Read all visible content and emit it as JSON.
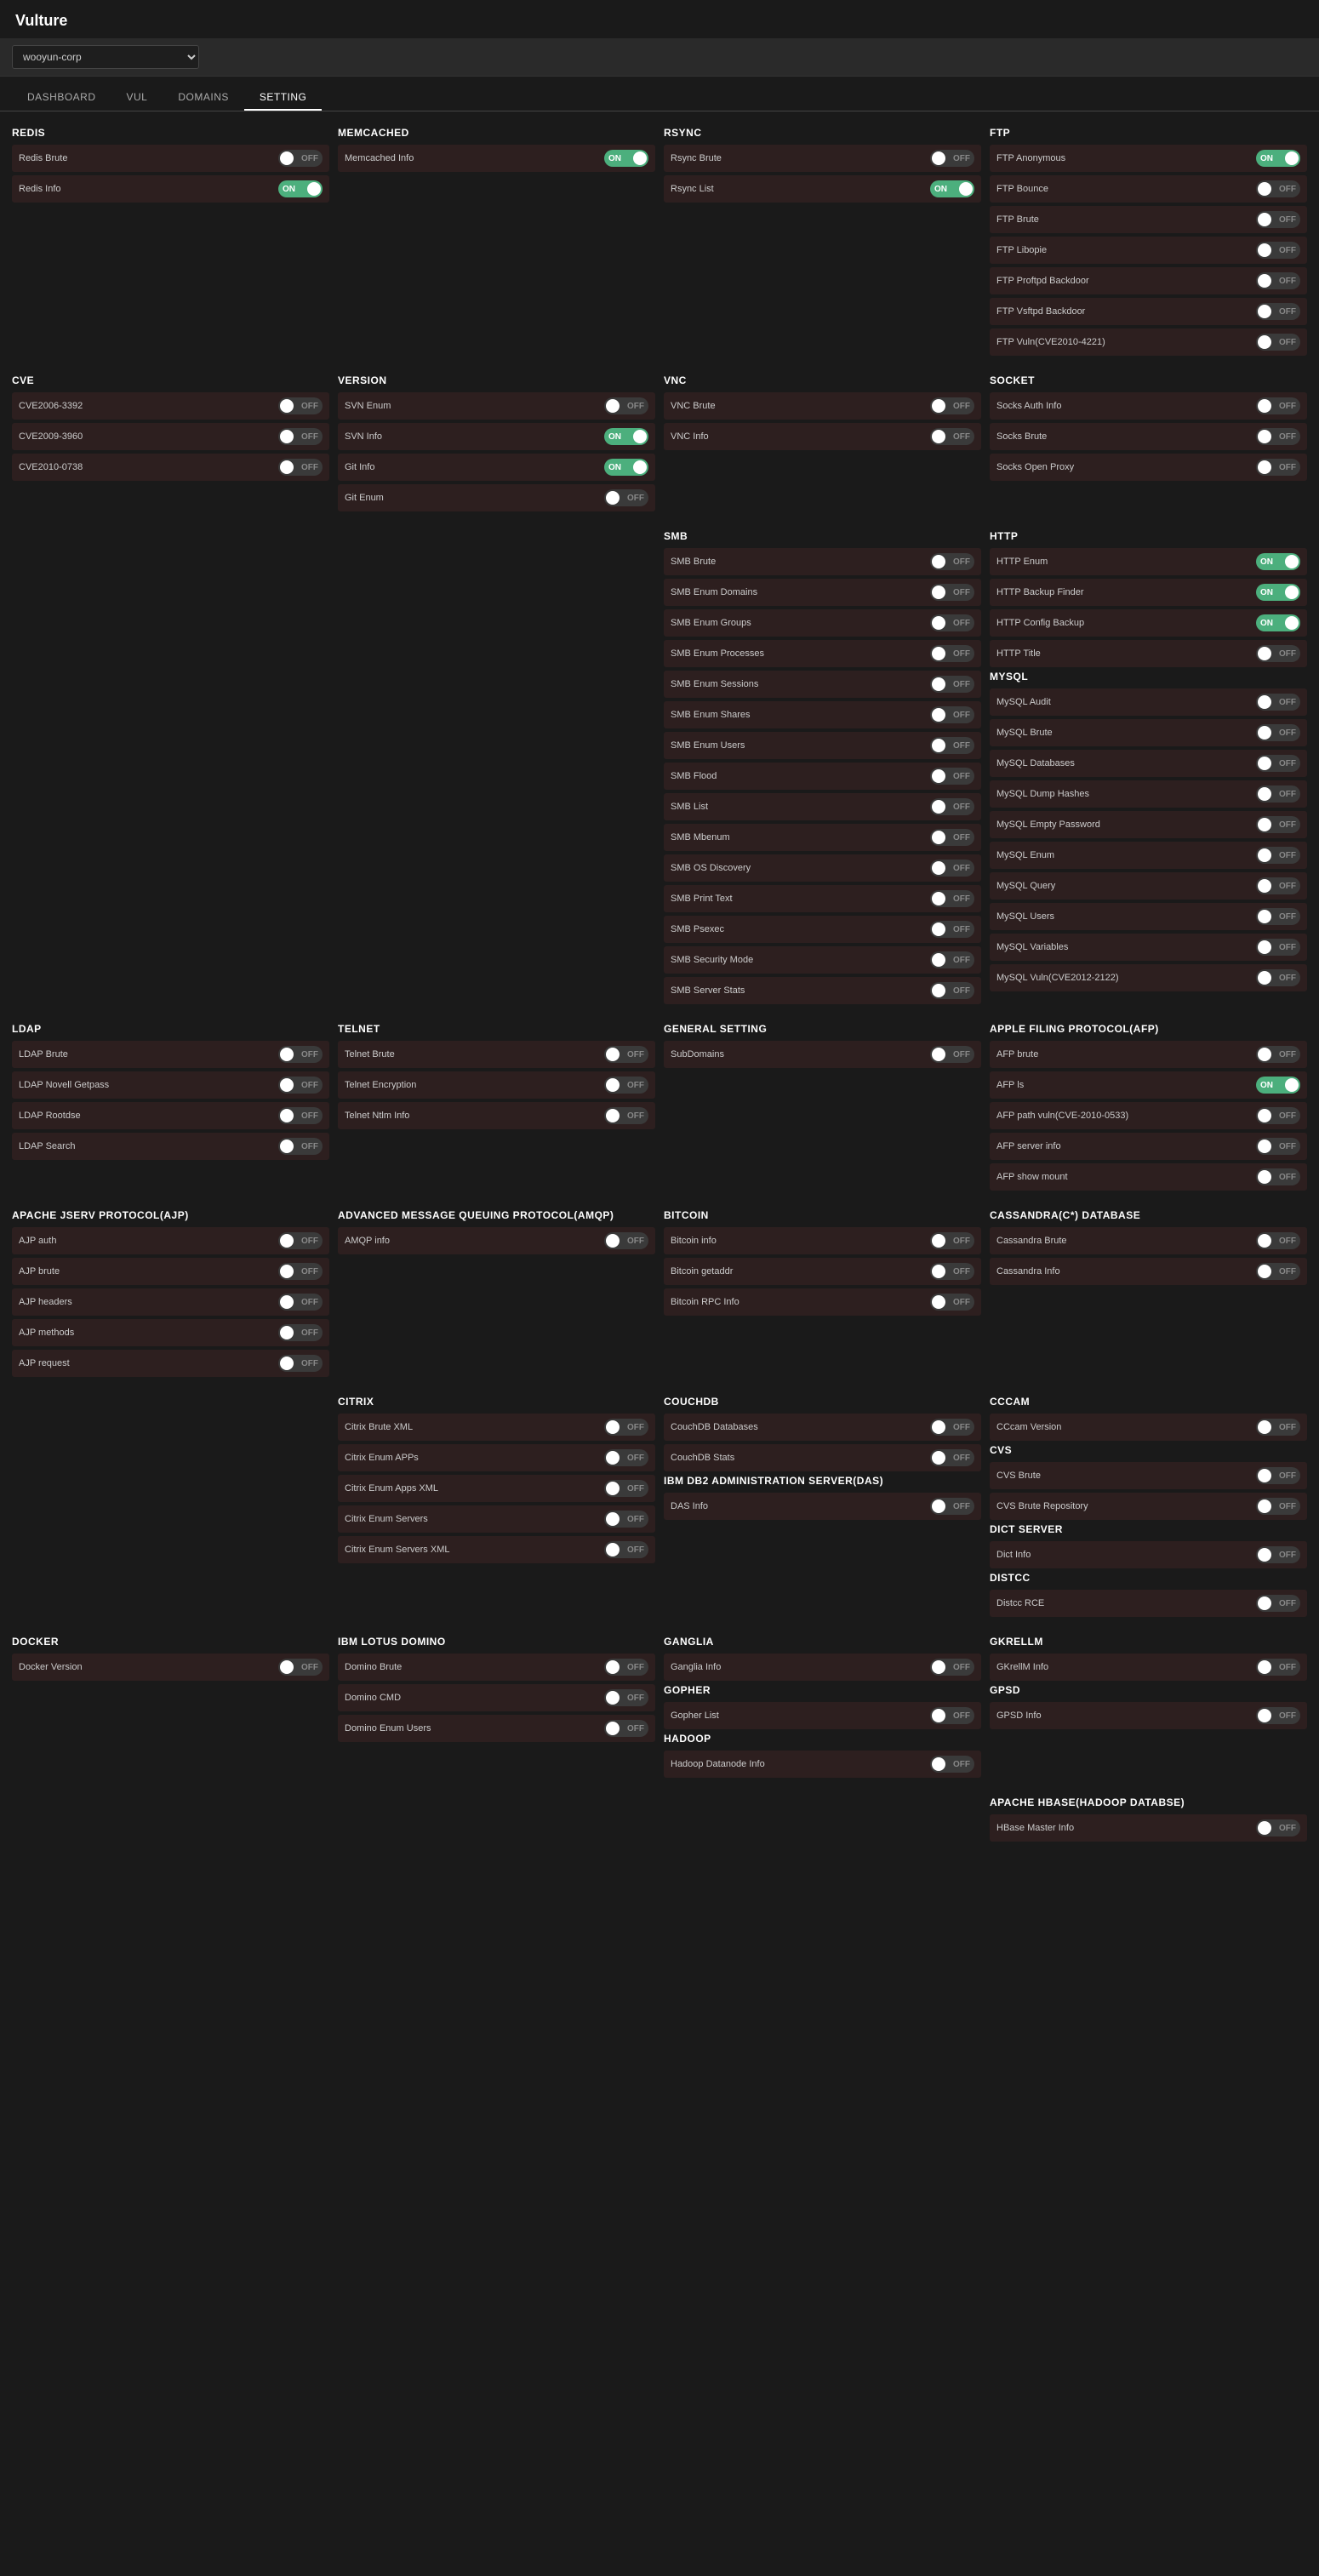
{
  "app": {
    "title": "Vulture"
  },
  "topbar": {
    "org": "wooyun-corp"
  },
  "nav": {
    "tabs": [
      {
        "label": "DASHBOARD",
        "active": false
      },
      {
        "label": "VUL",
        "active": false
      },
      {
        "label": "DOMAINS",
        "active": false
      },
      {
        "label": "SETTING",
        "active": true
      }
    ]
  },
  "sections": [
    {
      "title": "REDIS",
      "col": 0,
      "row": 0,
      "items": [
        {
          "label": "Redis Brute",
          "state": "off"
        },
        {
          "label": "Redis Info",
          "state": "on"
        }
      ]
    },
    {
      "title": "MEMCACHED",
      "col": 1,
      "row": 0,
      "items": [
        {
          "label": "Memcached Info",
          "state": "on"
        }
      ]
    },
    {
      "title": "RSYNC",
      "col": 2,
      "row": 0,
      "items": [
        {
          "label": "Rsync Brute",
          "state": "off"
        },
        {
          "label": "Rsync List",
          "state": "on"
        }
      ]
    },
    {
      "title": "FTP",
      "col": 3,
      "row": 0,
      "items": [
        {
          "label": "FTP Anonymous",
          "state": "on"
        },
        {
          "label": "FTP Bounce",
          "state": "off"
        },
        {
          "label": "FTP Brute",
          "state": "off"
        },
        {
          "label": "FTP Libopie",
          "state": "off"
        },
        {
          "label": "FTP Proftpd Backdoor",
          "state": "off"
        },
        {
          "label": "FTP Vsftpd Backdoor",
          "state": "off"
        },
        {
          "label": "FTP Vuln(CVE2010-4221)",
          "state": "off"
        }
      ]
    },
    {
      "title": "CVE",
      "col": 0,
      "row": 1,
      "items": [
        {
          "label": "CVE2006-3392",
          "state": "off"
        },
        {
          "label": "CVE2009-3960",
          "state": "off"
        },
        {
          "label": "CVE2010-0738",
          "state": "off"
        }
      ]
    },
    {
      "title": "VERSION",
      "col": 1,
      "row": 1,
      "items": [
        {
          "label": "SVN Enum",
          "state": "off"
        },
        {
          "label": "SVN Info",
          "state": "on"
        },
        {
          "label": "Git Info",
          "state": "on"
        },
        {
          "label": "Git Enum",
          "state": "off"
        }
      ]
    },
    {
      "title": "VNC",
      "col": 2,
      "row": 1,
      "items": [
        {
          "label": "VNC Brute",
          "state": "off"
        },
        {
          "label": "VNC Info",
          "state": "off"
        }
      ]
    },
    {
      "title": "SOCKET",
      "col": 3,
      "row": 1,
      "items": [
        {
          "label": "Socks Auth Info",
          "state": "off"
        },
        {
          "label": "Socks Brute",
          "state": "off"
        },
        {
          "label": "Socks Open Proxy",
          "state": "off"
        }
      ]
    },
    {
      "title": "SMB",
      "col": 2,
      "row": 2,
      "items": [
        {
          "label": "SMB Brute",
          "state": "off"
        },
        {
          "label": "SMB Enum Domains",
          "state": "off"
        },
        {
          "label": "SMB Enum Groups",
          "state": "off"
        },
        {
          "label": "SMB Enum Processes",
          "state": "off"
        },
        {
          "label": "SMB Enum Sessions",
          "state": "off"
        },
        {
          "label": "SMB Enum Shares",
          "state": "off"
        },
        {
          "label": "SMB Enum Users",
          "state": "off"
        },
        {
          "label": "SMB Flood",
          "state": "off"
        },
        {
          "label": "SMB List",
          "state": "off"
        },
        {
          "label": "SMB Mbenum",
          "state": "off"
        },
        {
          "label": "SMB OS Discovery",
          "state": "off"
        },
        {
          "label": "SMB Print Text",
          "state": "off"
        },
        {
          "label": "SMB Psexec",
          "state": "off"
        },
        {
          "label": "SMB Security Mode",
          "state": "off"
        },
        {
          "label": "SMB Server Stats",
          "state": "off"
        }
      ]
    },
    {
      "title": "HTTP",
      "col": 3,
      "row": 2,
      "items": [
        {
          "label": "HTTP Enum",
          "state": "on"
        },
        {
          "label": "HTTP Backup Finder",
          "state": "on"
        },
        {
          "label": "HTTP Config Backup",
          "state": "on"
        },
        {
          "label": "HTTP Title",
          "state": "off"
        }
      ]
    },
    {
      "title": "MYSQL",
      "col": 3,
      "row": 3,
      "items": [
        {
          "label": "MySQL Audit",
          "state": "off"
        },
        {
          "label": "MySQL Brute",
          "state": "off"
        },
        {
          "label": "MySQL Databases",
          "state": "off"
        },
        {
          "label": "MySQL Dump Hashes",
          "state": "off"
        },
        {
          "label": "MySQL Empty Password",
          "state": "off"
        },
        {
          "label": "MySQL Enum",
          "state": "off"
        },
        {
          "label": "MySQL Query",
          "state": "off"
        },
        {
          "label": "MySQL Users",
          "state": "off"
        },
        {
          "label": "MySQL Variables",
          "state": "off"
        },
        {
          "label": "MySQL Vuln(CVE2012-2122)",
          "state": "off"
        }
      ]
    },
    {
      "title": "LDAP",
      "col": 0,
      "row": 4,
      "items": [
        {
          "label": "LDAP Brute",
          "state": "off"
        },
        {
          "label": "LDAP Novell Getpass",
          "state": "off"
        },
        {
          "label": "LDAP Rootdse",
          "state": "off"
        },
        {
          "label": "LDAP Search",
          "state": "off"
        }
      ]
    },
    {
      "title": "TELNET",
      "col": 1,
      "row": 4,
      "items": [
        {
          "label": "Telnet Brute",
          "state": "off"
        },
        {
          "label": "Telnet Encryption",
          "state": "off"
        },
        {
          "label": "Telnet Ntlm Info",
          "state": "off"
        }
      ]
    },
    {
      "title": "GENERAL SETTING",
      "col": 2,
      "row": 4,
      "items": [
        {
          "label": "SubDomains",
          "state": "off"
        }
      ]
    },
    {
      "title": "APPLE FILING PROTOCOL(AFP)",
      "col": 3,
      "row": 4,
      "items": [
        {
          "label": "AFP brute",
          "state": "off"
        },
        {
          "label": "AFP ls",
          "state": "on"
        },
        {
          "label": "AFP path vuln(CVE-2010-0533)",
          "state": "off"
        },
        {
          "label": "AFP server info",
          "state": "off"
        },
        {
          "label": "AFP show mount",
          "state": "off"
        }
      ]
    },
    {
      "title": "APACHE JSERV PROTOCOL(AJP)",
      "col": 0,
      "row": 5,
      "items": [
        {
          "label": "AJP auth",
          "state": "off"
        },
        {
          "label": "AJP brute",
          "state": "off"
        },
        {
          "label": "AJP headers",
          "state": "off"
        },
        {
          "label": "AJP methods",
          "state": "off"
        },
        {
          "label": "AJP request",
          "state": "off"
        }
      ]
    },
    {
      "title": "ADVANCED MESSAGE QUEUING PROTOCOL(AMQP)",
      "col": 1,
      "row": 5,
      "items": [
        {
          "label": "AMQP info",
          "state": "off"
        }
      ]
    },
    {
      "title": "BITCOIN",
      "col": 2,
      "row": 5,
      "items": [
        {
          "label": "Bitcoin info",
          "state": "off"
        },
        {
          "label": "Bitcoin getaddr",
          "state": "off"
        },
        {
          "label": "Bitcoin RPC Info",
          "state": "off"
        }
      ]
    },
    {
      "title": "CASSANDRA(C*) DATABASE",
      "col": 3,
      "row": 5,
      "items": [
        {
          "label": "Cassandra Brute",
          "state": "off"
        },
        {
          "label": "Cassandra Info",
          "state": "off"
        }
      ]
    },
    {
      "title": "CITRIX",
      "col": 1,
      "row": 6,
      "items": [
        {
          "label": "Citrix Brute XML",
          "state": "off"
        },
        {
          "label": "Citrix Enum APPs",
          "state": "off"
        },
        {
          "label": "Citrix Enum Apps XML",
          "state": "off"
        },
        {
          "label": "Citrix Enum Servers",
          "state": "off"
        },
        {
          "label": "Citrix Enum Servers XML",
          "state": "off"
        }
      ]
    },
    {
      "title": "CCCAM",
      "col": 3,
      "row": 6,
      "items": [
        {
          "label": "CCcam Version",
          "state": "off"
        }
      ]
    },
    {
      "title": "CVS",
      "col": 3,
      "row": 6,
      "extraOffset": true,
      "items": [
        {
          "label": "CVS Brute",
          "state": "off"
        },
        {
          "label": "CVS Brute Repository",
          "state": "off"
        }
      ]
    },
    {
      "title": "COUCHDB",
      "col": 2,
      "row": 6,
      "items": [
        {
          "label": "CouchDB Databases",
          "state": "off"
        },
        {
          "label": "CouchDB Stats",
          "state": "off"
        }
      ]
    },
    {
      "title": "IBM DB2 ADMINISTRATION SERVER(DAS)",
      "col": 2,
      "row": 6,
      "extraOffset": true,
      "items": [
        {
          "label": "DAS Info",
          "state": "off"
        }
      ]
    },
    {
      "title": "DICT SERVER",
      "col": 3,
      "row": 7,
      "items": [
        {
          "label": "Dict Info",
          "state": "off"
        }
      ]
    },
    {
      "title": "DISTCC",
      "col": 3,
      "row": 7,
      "extraOffset": true,
      "items": [
        {
          "label": "Distcc RCE",
          "state": "off"
        }
      ]
    },
    {
      "title": "DOCKER",
      "col": 0,
      "row": 7,
      "items": [
        {
          "label": "Docker Version",
          "state": "off"
        }
      ]
    },
    {
      "title": "IBM LOTUS DOMINO",
      "col": 1,
      "row": 7,
      "items": [
        {
          "label": "Domino Brute",
          "state": "off"
        },
        {
          "label": "Domino CMD",
          "state": "off"
        },
        {
          "label": "Domino Enum Users",
          "state": "off"
        }
      ]
    },
    {
      "title": "GANGLIA",
      "col": 2,
      "row": 7,
      "items": [
        {
          "label": "Ganglia Info",
          "state": "off"
        }
      ]
    },
    {
      "title": "GKRELLM",
      "col": 3,
      "row": 8,
      "items": [
        {
          "label": "GKrellM Info",
          "state": "off"
        }
      ]
    },
    {
      "title": "GPSD",
      "col": 3,
      "row": 8,
      "extraOffset": true,
      "items": [
        {
          "label": "GPSD Info",
          "state": "off"
        }
      ]
    },
    {
      "title": "GOPHER",
      "col": 2,
      "row": 8,
      "items": [
        {
          "label": "Gopher List",
          "state": "off"
        }
      ]
    },
    {
      "title": "HADOOP",
      "col": 2,
      "row": 8,
      "extraOffset": true,
      "items": [
        {
          "label": "Hadoop Datanode Info",
          "state": "off"
        }
      ]
    },
    {
      "title": "APACHE HBASE(HADOOP DATABSE)",
      "col": 3,
      "row": 9,
      "items": [
        {
          "label": "HBase Master Info",
          "state": "off"
        }
      ]
    }
  ]
}
